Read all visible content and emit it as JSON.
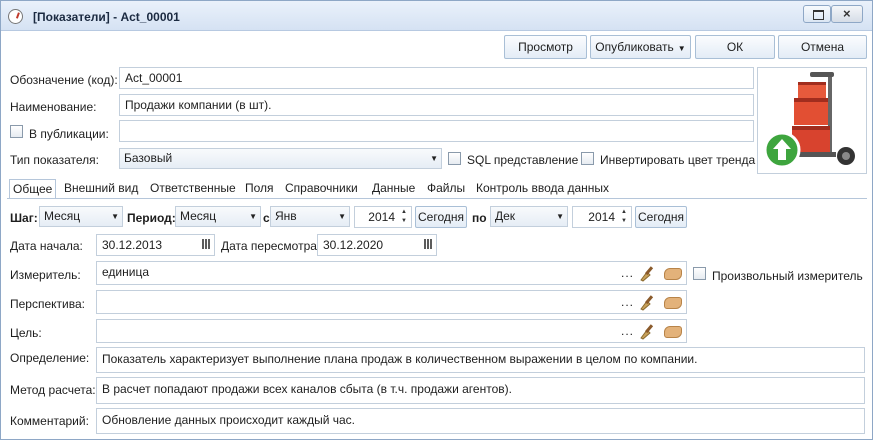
{
  "window": {
    "title": "[Показатели] - Act_00001",
    "restore_icon": "restore-icon",
    "close_glyph": "×"
  },
  "toolbar": {
    "view_label": "Просмотр",
    "publish_label": "Опубликовать",
    "ok_label": "ОК",
    "cancel_label": "Отмена"
  },
  "form": {
    "code_label": "Обозначение (код):",
    "code_value": "Act_00001",
    "name_label": "Наименование:",
    "name_value": "Продажи компании (в шт).",
    "publication_label": "В публикации:",
    "publication_value": "",
    "type_label": "Тип показателя:",
    "type_value": "Базовый",
    "sql_label": "SQL представление",
    "invert_label": "Инвертировать цвет тренда"
  },
  "tabs": [
    "Общее",
    "Внешний вид",
    "Ответственные",
    "Поля",
    "Справочники",
    "Данные",
    "Файлы",
    "Контроль ввода данных"
  ],
  "general": {
    "step_label": "Шаг:",
    "step_value": "Месяц",
    "period_label": "Период:",
    "period_value": "Месяц",
    "from_label": "с",
    "from_month": "Янв",
    "from_year": "2014",
    "today_label": "Сегодня",
    "to_label": "по",
    "to_month": "Дек",
    "to_year": "2014",
    "today_label_2": "Сегодня",
    "start_date_label": "Дата начала:",
    "start_date_value": "30.12.2013",
    "review_date_label": "Дата пересмотра:",
    "review_date_value": "30.12.2020",
    "meter_label": "Измеритель:",
    "meter_value": "единица",
    "custom_meter_label": "Произвольный измеритель",
    "perspective_label": "Перспектива:",
    "perspective_value": "",
    "goal_label": "Цель:",
    "goal_value": "",
    "definition_label": "Определение:",
    "definition_value": "Показатель характеризует выполнение плана продаж в количественном выражении в целом по компании.",
    "method_label": "Метод расчета:",
    "method_value": "В расчет попадают продажи всех каналов сбыта (в т.ч. продажи агентов).",
    "comment_label": "Комментарий:",
    "comment_value": "Обновление данных происходит каждый час.",
    "ellipsis": "..."
  },
  "colors": {
    "accent": "#4a90d9",
    "border": "#c3cfdc"
  }
}
